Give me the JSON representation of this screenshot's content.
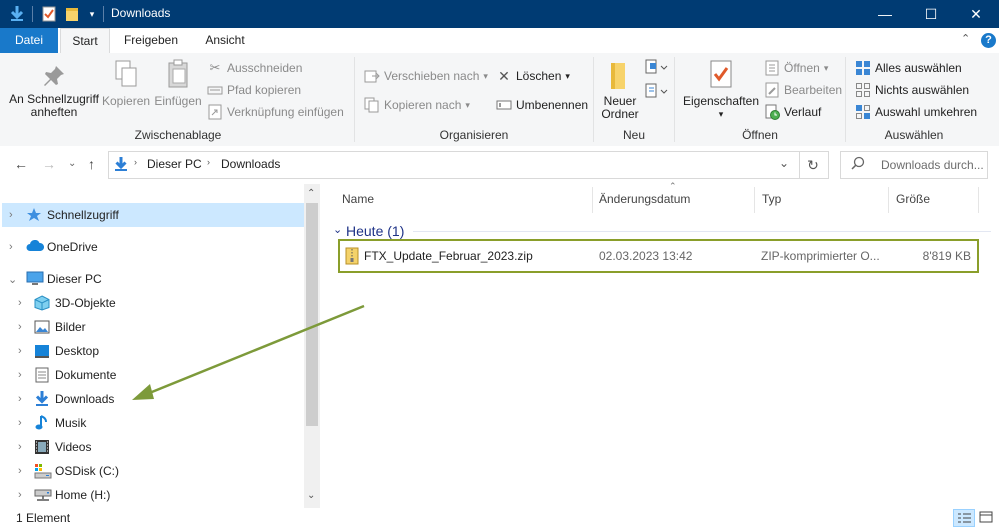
{
  "window": {
    "title": "Downloads",
    "minimize_glyph": "—",
    "maximize_glyph": "☐",
    "close_glyph": "✕"
  },
  "ribbon_tabs": {
    "datei": "Datei",
    "start": "Start",
    "freigeben": "Freigeben",
    "ansicht": "Ansicht"
  },
  "ribbon": {
    "clipboard": {
      "pin_label_1": "An Schnellzugriff",
      "pin_label_2": "anheften",
      "copy": "Kopieren",
      "paste": "Einfügen",
      "cut": "Ausschneiden",
      "copy_path": "Pfad kopieren",
      "paste_shortcut": "Verknüpfung einfügen",
      "group_label": "Zwischenablage"
    },
    "organize": {
      "move_to": "Verschieben nach",
      "copy_to": "Kopieren nach",
      "delete": "Löschen",
      "rename": "Umbenennen",
      "group_label": "Organisieren"
    },
    "new": {
      "new_folder_1": "Neuer",
      "new_folder_2": "Ordner",
      "group_label": "Neu"
    },
    "open": {
      "properties": "Eigenschaften",
      "open": "Öffnen",
      "edit": "Bearbeiten",
      "history": "Verlauf",
      "group_label": "Öffnen"
    },
    "select": {
      "select_all": "Alles auswählen",
      "select_none": "Nichts auswählen",
      "invert": "Auswahl umkehren",
      "group_label": "Auswählen"
    }
  },
  "address": {
    "crumbs": [
      "Dieser PC",
      "Downloads"
    ],
    "search_placeholder": "Downloads durch..."
  },
  "navpane": {
    "items": [
      {
        "label": "Schnellzugriff",
        "icon": "star-icon"
      },
      {
        "label": "OneDrive",
        "icon": "cloud-icon"
      },
      {
        "label": "Dieser PC",
        "icon": "computer-icon"
      },
      {
        "label": "3D-Objekte",
        "icon": "cube-icon"
      },
      {
        "label": "Bilder",
        "icon": "pictures-icon"
      },
      {
        "label": "Desktop",
        "icon": "desktop-icon"
      },
      {
        "label": "Dokumente",
        "icon": "documents-icon"
      },
      {
        "label": "Downloads",
        "icon": "download-icon"
      },
      {
        "label": "Musik",
        "icon": "music-icon"
      },
      {
        "label": "Videos",
        "icon": "video-icon"
      },
      {
        "label": "OSDisk (C:)",
        "icon": "drive-icon"
      },
      {
        "label": "Home (H:)",
        "icon": "network-drive-icon"
      }
    ]
  },
  "filelist": {
    "columns": {
      "name": "Name",
      "modified": "Änderungsdatum",
      "type": "Typ",
      "size": "Größe"
    },
    "group_header": "Heute (1)",
    "files": [
      {
        "name": "FTX_Update_Februar_2023.zip",
        "modified": "02.03.2023 13:42",
        "type": "ZIP-komprimierter O...",
        "size": "8'819 KB"
      }
    ]
  },
  "status": {
    "count": "1 Element"
  },
  "colors": {
    "titlebar": "#003b73",
    "file_tab": "#1979ca",
    "highlight_box": "#8a9e2a",
    "arrow": "#7d9a3a",
    "selection": "#cce8ff"
  }
}
